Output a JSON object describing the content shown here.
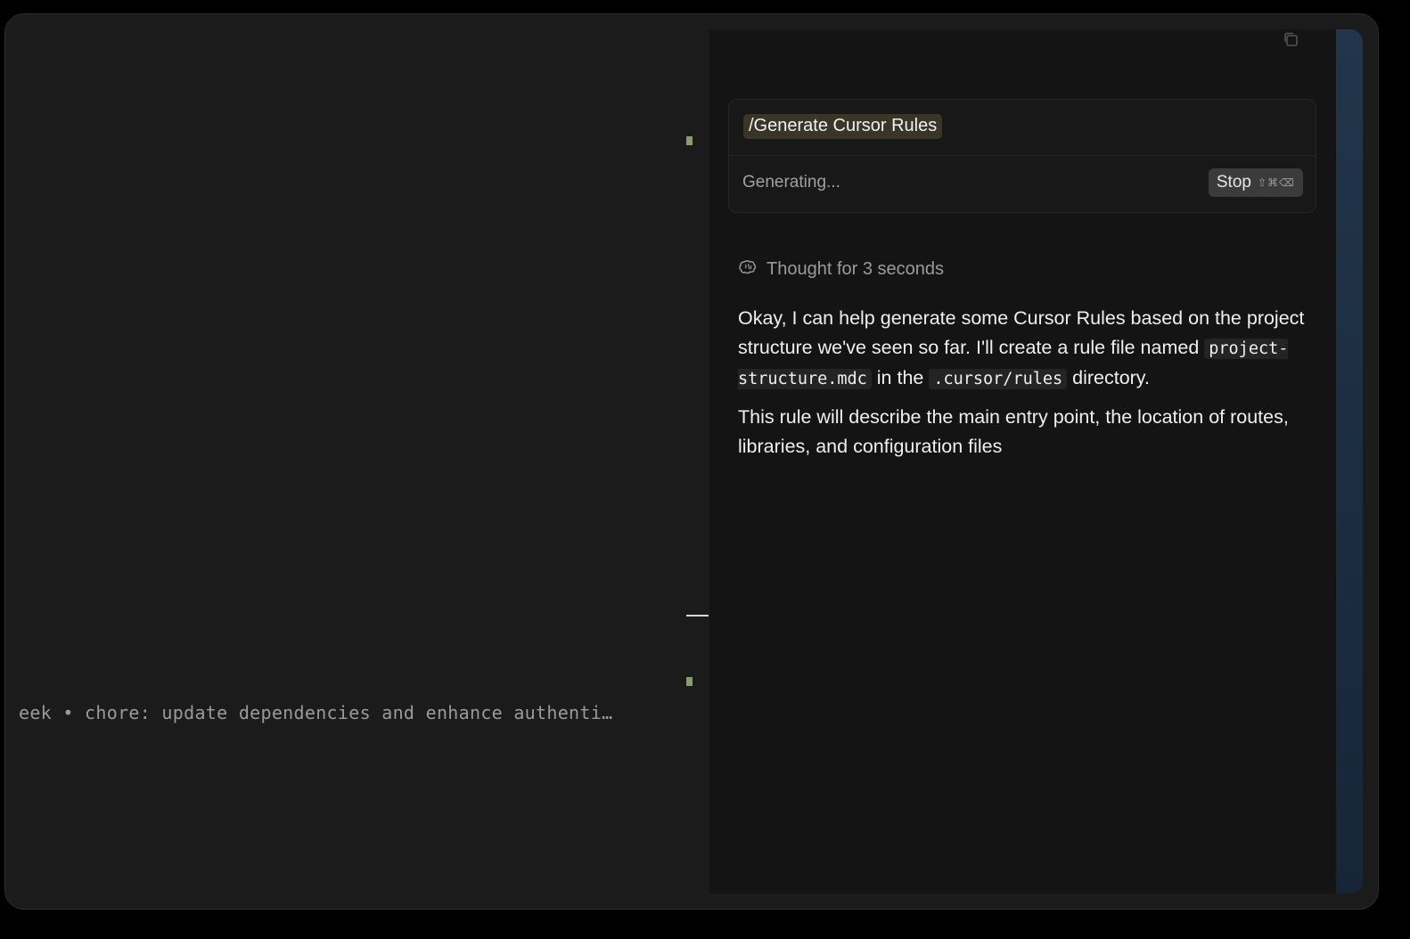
{
  "editor": {
    "git_blame": "eek • chore: update dependencies and enhance authenti…"
  },
  "chat": {
    "command": "/Generate Cursor Rules",
    "status": "Generating...",
    "stop_button": {
      "label": "Stop",
      "shortcut": "⇧⌘⌫"
    },
    "thought": "Thought for 3 seconds",
    "message": {
      "p1_text1": "Okay, I can help generate some Cursor Rules based on the project structure we've seen so far. I'll create a rule file named ",
      "p1_code1": "project-structure.mdc",
      "p1_text2": " in the ",
      "p1_code2": ".cursor/rules",
      "p1_text3": " directory.",
      "p2": "This rule will describe the main entry point, the location of routes, libraries, and configuration files"
    }
  },
  "icons": {
    "copy": "copy-icon",
    "thought": "brain-icon"
  },
  "colors": {
    "command_pill": "#3a3627",
    "stop_button": "#3b3b3b",
    "side_strip": "#1c2d42"
  }
}
